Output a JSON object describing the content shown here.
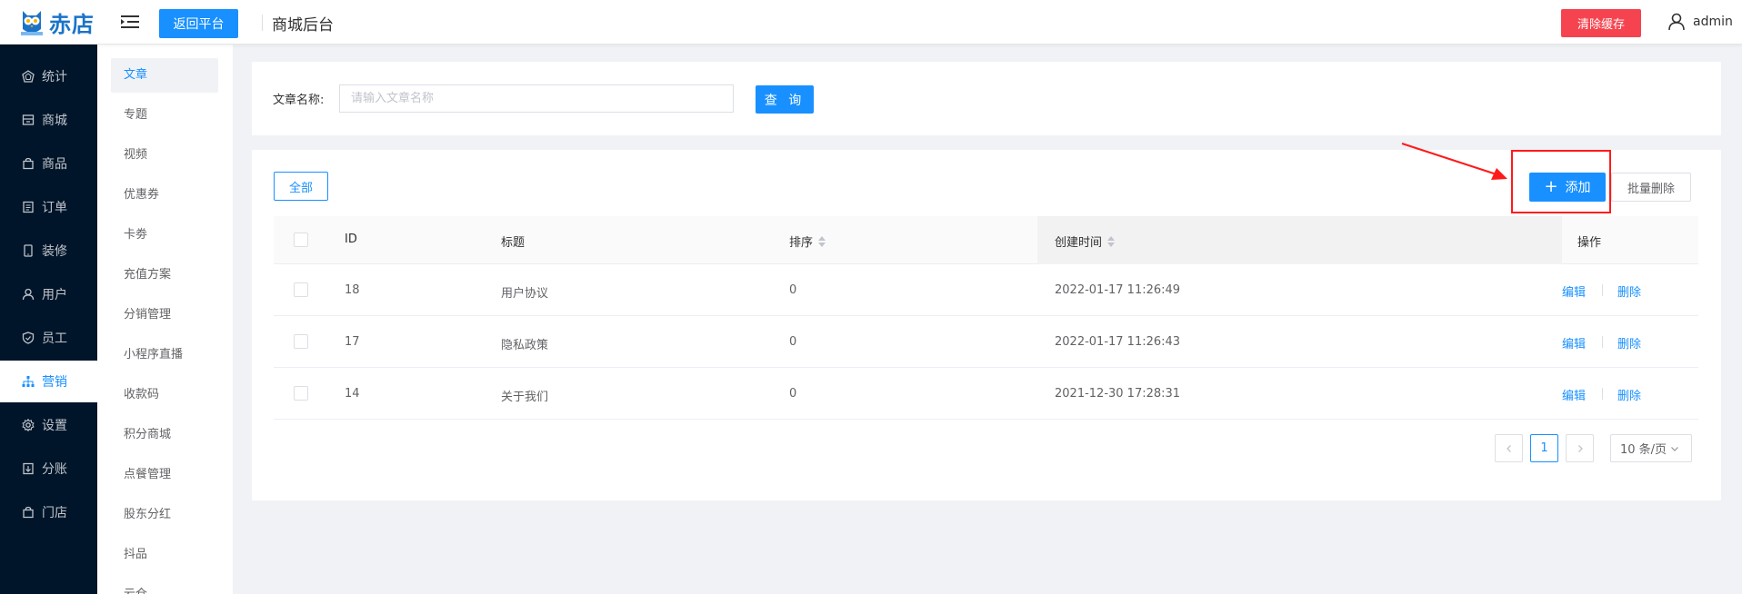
{
  "header": {
    "logo_text": "赤店",
    "back_button": "返回平台",
    "title": "商城后台",
    "clear_cache_button": "清除缓存",
    "username": "admin"
  },
  "sidebar": {
    "items": [
      {
        "label": "统计",
        "icon": "chart-icon"
      },
      {
        "label": "商城",
        "icon": "store-icon"
      },
      {
        "label": "商品",
        "icon": "bag-icon"
      },
      {
        "label": "订单",
        "icon": "order-icon"
      },
      {
        "label": "装修",
        "icon": "phone-icon"
      },
      {
        "label": "用户",
        "icon": "user-icon"
      },
      {
        "label": "员工",
        "icon": "shield-icon"
      },
      {
        "label": "营销",
        "icon": "sitemap-icon",
        "active": true
      },
      {
        "label": "设置",
        "icon": "gear-icon"
      },
      {
        "label": "分账",
        "icon": "split-icon"
      },
      {
        "label": "门店",
        "icon": "shop-icon"
      }
    ]
  },
  "submenu": {
    "items": [
      "文章",
      "专题",
      "视频",
      "优惠券",
      "卡劵",
      "充值方案",
      "分销管理",
      "小程序直播",
      "收款码",
      "积分商城",
      "点餐管理",
      "股东分红",
      "抖品",
      "云仓"
    ],
    "active_index": 0
  },
  "search": {
    "label": "文章名称:",
    "placeholder": "请输入文章名称",
    "value": "",
    "button": "查 询"
  },
  "toolbar": {
    "all_button": "全部",
    "add_button": "添加",
    "batch_delete_button": "批量删除"
  },
  "table": {
    "columns": [
      "ID",
      "标题",
      "排序",
      "创建时间",
      "操作"
    ],
    "rows": [
      {
        "id": "18",
        "title": "用户协议",
        "sort": "0",
        "created": "2022-01-17 11:26:49"
      },
      {
        "id": "17",
        "title": "隐私政策",
        "sort": "0",
        "created": "2022-01-17 11:26:43"
      },
      {
        "id": "14",
        "title": "关于我们",
        "sort": "0",
        "created": "2021-12-30 17:28:31"
      }
    ],
    "edit_label": "编辑",
    "delete_label": "删除"
  },
  "pagination": {
    "current_page": "1",
    "page_size": "10 条/页"
  },
  "colors": {
    "primary": "#1890ff",
    "danger": "#f5444f",
    "sidebar_bg": "#001529",
    "annotation": "#ff1a1a"
  }
}
